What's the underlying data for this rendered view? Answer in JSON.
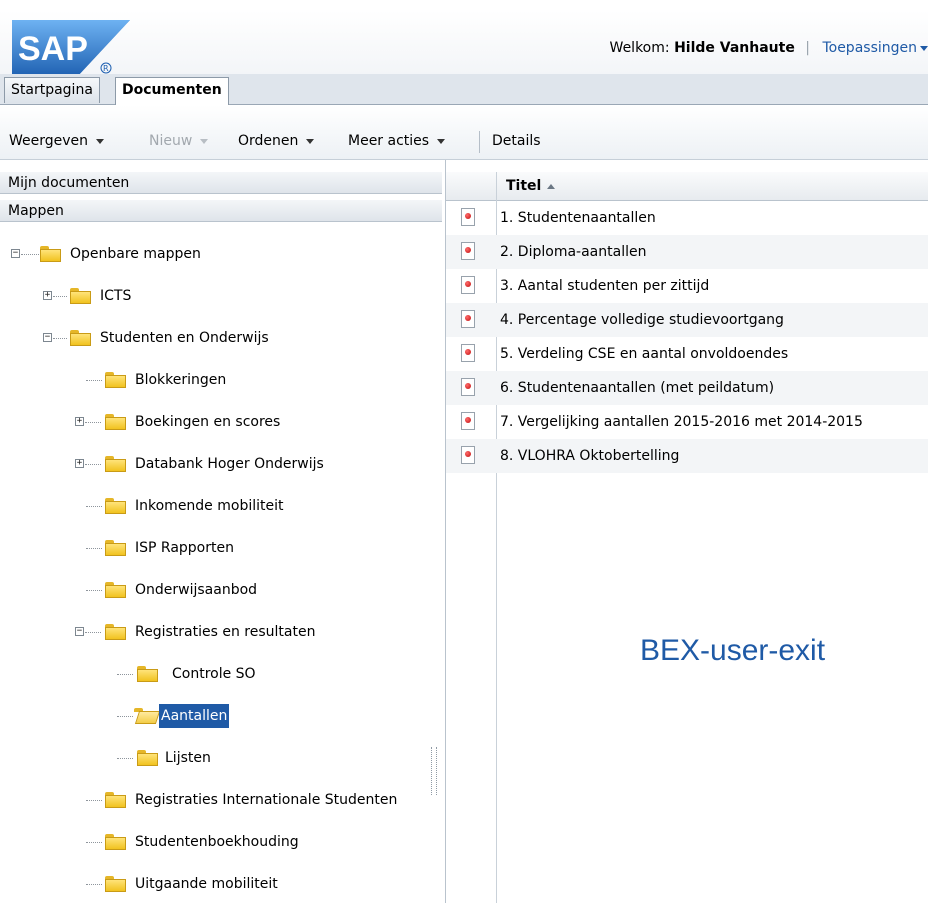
{
  "header": {
    "logo_text": "SAP",
    "welcome_prefix": "Welkom:",
    "user_name": "Hilde Vanhaute",
    "separator": "|",
    "apps_label": "Toepassingen"
  },
  "tabs": [
    {
      "label": "Startpagina"
    },
    {
      "label": "Documenten"
    }
  ],
  "toolbar": {
    "view_label": "Weergeven",
    "new_label": "Nieuw",
    "sort_label": "Ordenen",
    "more_label": "Meer acties",
    "details_label": "Details"
  },
  "left": {
    "my_documents": "Mijn documenten",
    "folders": "Mappen"
  },
  "tree": {
    "public": "Openbare mappen",
    "icts": "ICTS",
    "studenten": "Studenten en Onderwijs",
    "blokkeringen": "Blokkeringen",
    "boekingen": "Boekingen en scores",
    "databank": "Databank Hoger Onderwijs",
    "inkomende": "Inkomende mobiliteit",
    "isp": "ISP Rapporten",
    "aanbod": "Onderwijsaanbod",
    "registraties": "Registraties en resultaten",
    "controle": "Controle SO",
    "aantallen": "Aantallen",
    "lijsten": "Lijsten",
    "internationaal": "Registraties Internationale Studenten",
    "boekhouding": "Studentenboekhouding",
    "uitgaande": "Uitgaande mobiliteit"
  },
  "grid": {
    "title_header": "Titel",
    "rows": [
      "1. Studentenaantallen",
      "2. Diploma-aantallen",
      "3. Aantal studenten per zittijd",
      "4. Percentage volledige studievoortgang",
      "5. Verdeling CSE en aantal onvoldoendes",
      "6. Studentenaantallen (met peildatum)",
      "7. Vergelijking aantallen 2015-2016 met 2014-2015",
      "8. VLOHRA Oktobertelling"
    ]
  },
  "overlay_text": "BEX-user-exit"
}
